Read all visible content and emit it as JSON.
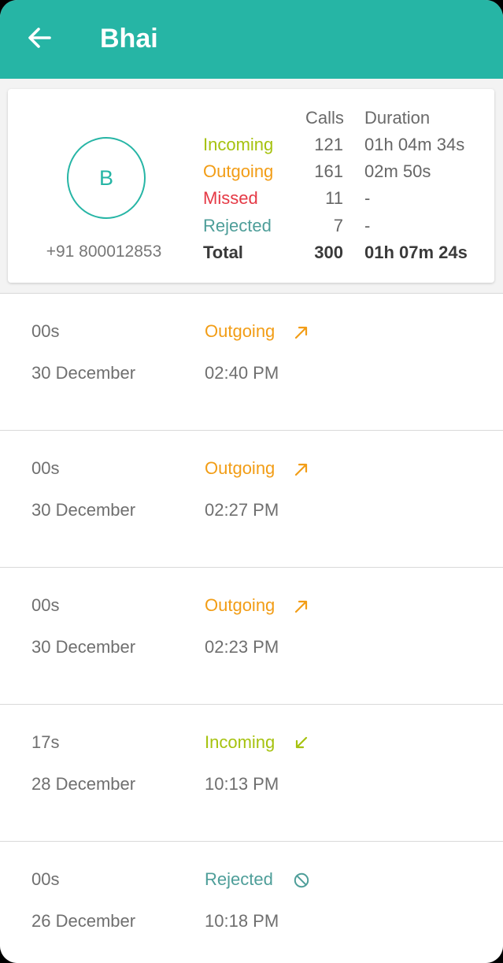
{
  "header": {
    "title": "Bhai",
    "back_icon": "arrow-left-icon",
    "bar_color": "#26b5a5"
  },
  "contact": {
    "initial": "B",
    "phone": "+91 800012853"
  },
  "summary": {
    "headers": {
      "calls": "Calls",
      "duration": "Duration"
    },
    "rows": [
      {
        "type": "Incoming",
        "calls": "121",
        "duration": "01h 04m 34s",
        "color": "#a6c20f"
      },
      {
        "type": "Outgoing",
        "calls": "161",
        "duration": "02m 50s",
        "color": "#f29d16"
      },
      {
        "type": "Missed",
        "calls": "11",
        "duration": "-",
        "color": "#e53945"
      },
      {
        "type": "Rejected",
        "calls": "7",
        "duration": "-",
        "color": "#4e9e99"
      },
      {
        "type": "Total",
        "calls": "300",
        "duration": "01h 07m 24s",
        "color": "#3a3a3a"
      }
    ]
  },
  "calls": [
    {
      "duration": "00s",
      "date": "30 December",
      "type": "Outgoing",
      "time": "02:40 PM",
      "icon": "call-made-icon",
      "color": "#f29d16"
    },
    {
      "duration": "00s",
      "date": "30 December",
      "type": "Outgoing",
      "time": "02:27 PM",
      "icon": "call-made-icon",
      "color": "#f29d16"
    },
    {
      "duration": "00s",
      "date": "30 December",
      "type": "Outgoing",
      "time": "02:23 PM",
      "icon": "call-made-icon",
      "color": "#f29d16"
    },
    {
      "duration": "17s",
      "date": "28 December",
      "type": "Incoming",
      "time": "10:13 PM",
      "icon": "call-received-icon",
      "color": "#a6c20f"
    },
    {
      "duration": "00s",
      "date": "26 December",
      "type": "Rejected",
      "time": "10:18 PM",
      "icon": "blocked-icon",
      "color": "#4e9e99"
    }
  ]
}
